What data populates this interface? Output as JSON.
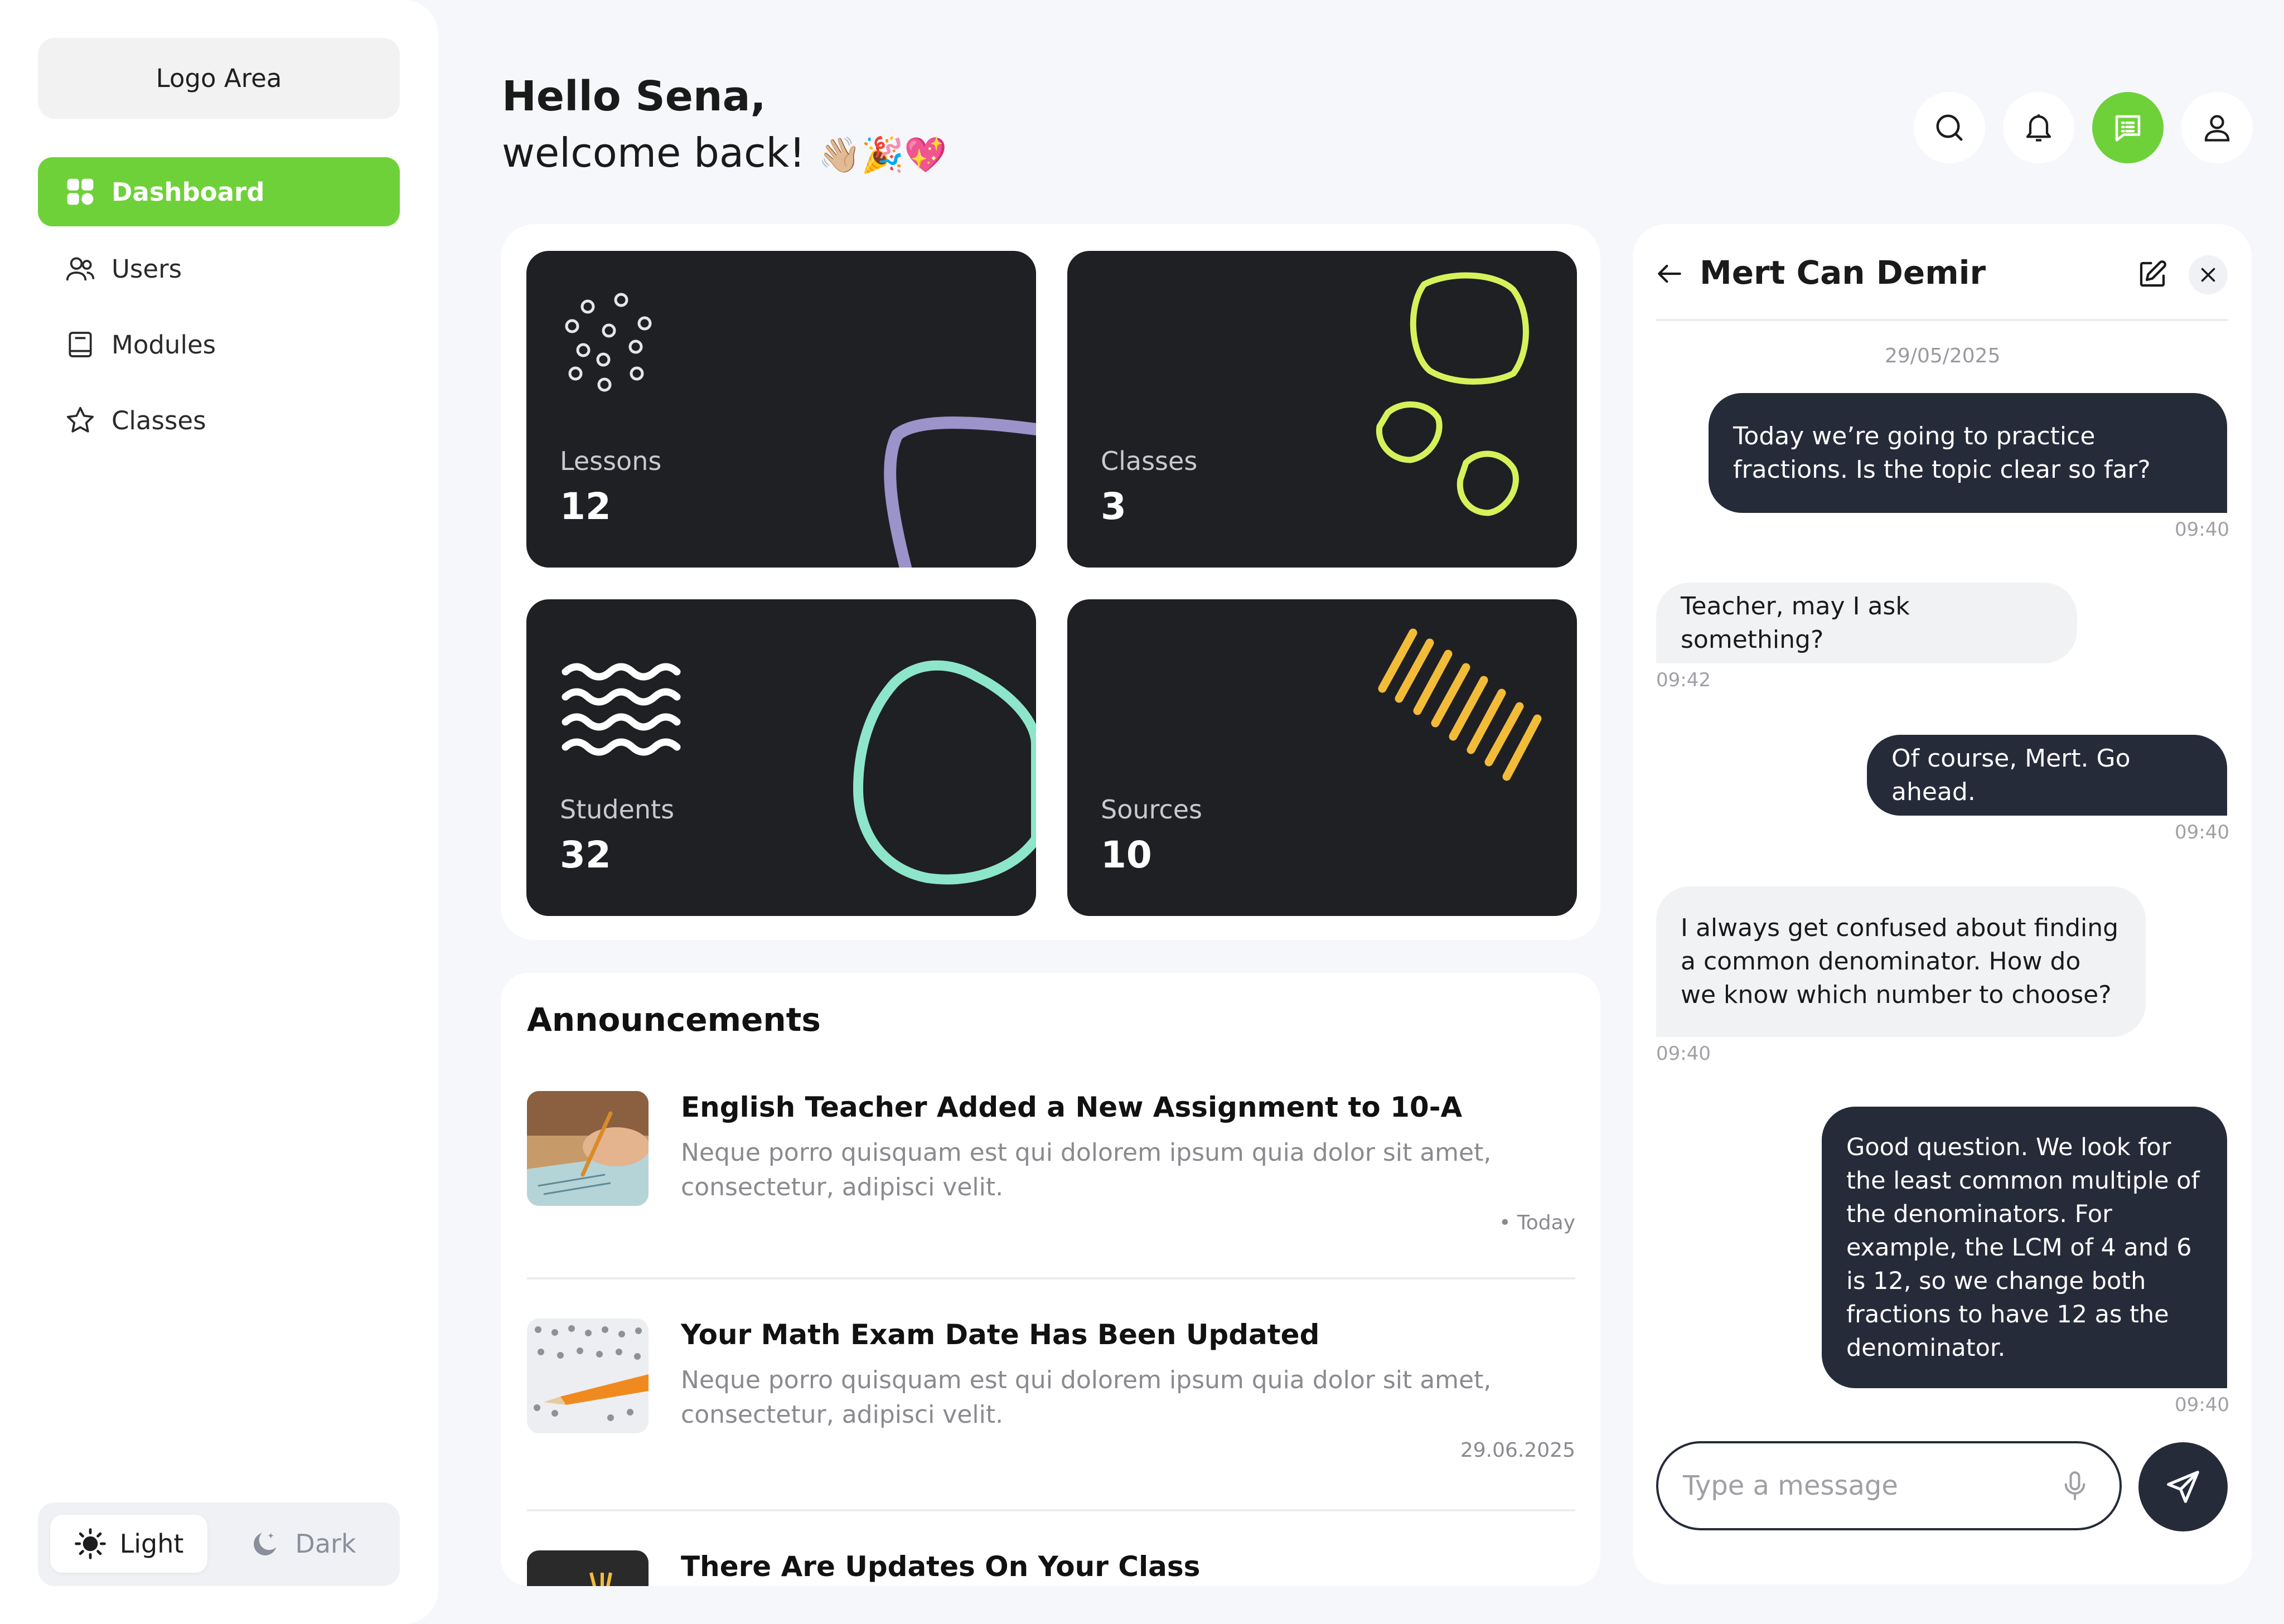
{
  "sidebar": {
    "logo": "Logo Area",
    "items": [
      {
        "label": "Dashboard",
        "icon": "grid-icon"
      },
      {
        "label": "Users",
        "icon": "users-icon"
      },
      {
        "label": "Modules",
        "icon": "book-icon"
      },
      {
        "label": "Classes",
        "icon": "star-icon"
      }
    ],
    "theme": {
      "light": "Light",
      "dark": "Dark"
    }
  },
  "header": {
    "greeting": "Hello Sena,",
    "welcome": "welcome back!",
    "emoji": "👋🏼🎉💖",
    "icons": [
      "search-icon",
      "bell-icon",
      "message-icon",
      "user-icon"
    ]
  },
  "stats": [
    {
      "label": "Lessons",
      "value": "12"
    },
    {
      "label": "Classes",
      "value": "3"
    },
    {
      "label": "Students",
      "value": "32"
    },
    {
      "label": "Sources",
      "value": "10"
    }
  ],
  "announcements": {
    "title": "Announcements",
    "items": [
      {
        "title": "English Teacher Added a New Assignment to 10-A",
        "desc": "Neque porro quisquam est qui dolorem ipsum quia dolor sit amet, consectetur, adipisci velit.",
        "date": "• Today"
      },
      {
        "title": "Your Math Exam Date Has Been Updated",
        "desc": "Neque porro quisquam est qui dolorem ipsum quia dolor sit amet, consectetur, adipisci velit.",
        "date": "29.06.2025"
      },
      {
        "title": "There Are Updates On Your Class"
      }
    ]
  },
  "chat": {
    "name": "Mert Can Demir",
    "date": "29/05/2025",
    "messages": [
      {
        "dir": "out",
        "text": "Today we’re going to practice fractions. Is the topic clear so far?",
        "time": "09:40"
      },
      {
        "dir": "in",
        "text": "Teacher, may I ask something?",
        "time": "09:42"
      },
      {
        "dir": "out",
        "text": "Of course, Mert. Go ahead.",
        "time": "09:40"
      },
      {
        "dir": "in",
        "text": "I always get confused about finding a common denominator. How do we know which number to choose?",
        "time": "09:40"
      },
      {
        "dir": "out",
        "text": "Good question. We look for the least common multiple of the denominators. For example, the LCM of 4 and 6 is 12, so we change both fractions to have 12 as the denominator.",
        "time": "09:40"
      }
    ],
    "input_placeholder": "Type a  message"
  },
  "colors": {
    "accent": "#6fd13a",
    "dark": "#1f2023",
    "bubble": "#262b3a"
  }
}
